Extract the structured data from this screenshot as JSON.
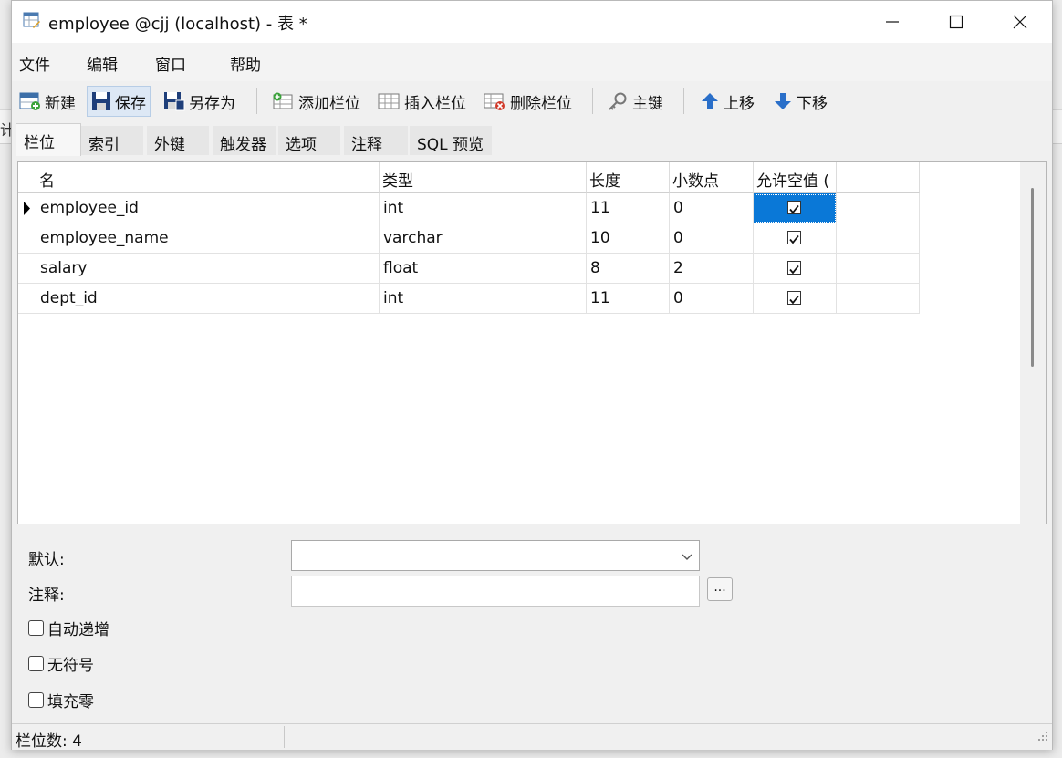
{
  "background": {
    "fragment": "计"
  },
  "window": {
    "title": "employee @cjj (localhost) - 表 *"
  },
  "menu": [
    "文件",
    "编辑",
    "窗口",
    "帮助"
  ],
  "toolbar": {
    "new": "新建",
    "save": "保存",
    "save_as": "另存为",
    "add_field": "添加栏位",
    "insert_field": "插入栏位",
    "delete_field": "删除栏位",
    "primary_key": "主键",
    "move_up": "上移",
    "move_down": "下移"
  },
  "tabs": [
    "栏位",
    "索引",
    "外键",
    "触发器",
    "选项",
    "注释",
    "SQL 预览"
  ],
  "grid": {
    "columns": [
      "名",
      "类型",
      "长度",
      "小数点",
      "允许空值 ("
    ],
    "rows": [
      {
        "name": "employee_id",
        "type": "int",
        "length": "11",
        "decimals": "0",
        "nullable": true
      },
      {
        "name": "employee_name",
        "type": "varchar",
        "length": "10",
        "decimals": "0",
        "nullable": true
      },
      {
        "name": "salary",
        "type": "float",
        "length": "8",
        "decimals": "2",
        "nullable": true
      },
      {
        "name": "dept_id",
        "type": "int",
        "length": "11",
        "decimals": "0",
        "nullable": true
      }
    ]
  },
  "props": {
    "default_label": "默认:",
    "comment_label": "注释:",
    "ellipsis": "...",
    "auto_increment": "自动递增",
    "unsigned": "无符号",
    "zerofill": "填充零"
  },
  "status": {
    "field_count": "栏位数: 4"
  },
  "colors": {
    "selection": "#0a78d7",
    "accent_blue": "#2a6fc9"
  }
}
